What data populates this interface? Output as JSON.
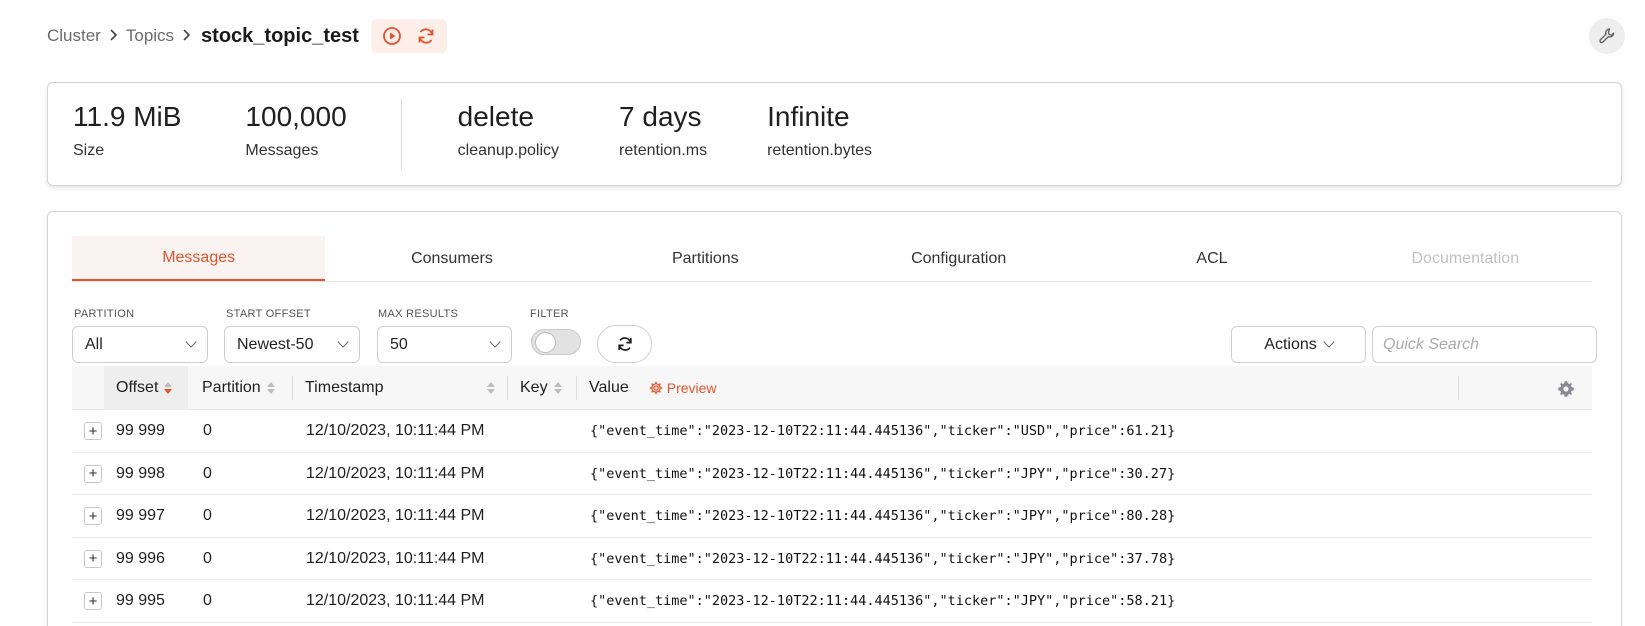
{
  "breadcrumb": {
    "items": [
      "Cluster",
      "Topics"
    ],
    "title": "stock_topic_test"
  },
  "header_icons": [
    "play-circle-icon",
    "refresh-icon",
    "wrench-icon"
  ],
  "stats": [
    {
      "value": "11.9 MiB",
      "label": "Size"
    },
    {
      "value": "100,000",
      "label": "Messages"
    },
    {
      "value": "delete",
      "label": "cleanup.policy"
    },
    {
      "value": "7 days",
      "label": "retention.ms"
    },
    {
      "value": "Infinite",
      "label": "retention.bytes"
    }
  ],
  "tabs": [
    {
      "label": "Messages",
      "state": "active"
    },
    {
      "label": "Consumers",
      "state": "normal"
    },
    {
      "label": "Partitions",
      "state": "normal"
    },
    {
      "label": "Configuration",
      "state": "normal"
    },
    {
      "label": "ACL",
      "state": "normal"
    },
    {
      "label": "Documentation",
      "state": "disabled"
    }
  ],
  "filters": {
    "partition": {
      "label": "PARTITION",
      "value": "All"
    },
    "start_offset": {
      "label": "START OFFSET",
      "value": "Newest-50"
    },
    "max_results": {
      "label": "MAX RESULTS",
      "value": "50"
    },
    "filter": {
      "label": "FILTER",
      "enabled": false
    },
    "actions_label": "Actions",
    "search_placeholder": "Quick Search"
  },
  "table": {
    "columns": {
      "offset": "Offset",
      "partition": "Partition",
      "timestamp": "Timestamp",
      "key": "Key",
      "value": "Value",
      "preview": "Preview"
    },
    "rows": [
      {
        "offset": "99 999",
        "partition": "0",
        "timestamp": "12/10/2023, 10:11:44 PM",
        "key": "",
        "value": "{\"event_time\":\"2023-12-10T22:11:44.445136\",\"ticker\":\"USD\",\"price\":61.21}"
      },
      {
        "offset": "99 998",
        "partition": "0",
        "timestamp": "12/10/2023, 10:11:44 PM",
        "key": "",
        "value": "{\"event_time\":\"2023-12-10T22:11:44.445136\",\"ticker\":\"JPY\",\"price\":30.27}"
      },
      {
        "offset": "99 997",
        "partition": "0",
        "timestamp": "12/10/2023, 10:11:44 PM",
        "key": "",
        "value": "{\"event_time\":\"2023-12-10T22:11:44.445136\",\"ticker\":\"JPY\",\"price\":80.28}"
      },
      {
        "offset": "99 996",
        "partition": "0",
        "timestamp": "12/10/2023, 10:11:44 PM",
        "key": "",
        "value": "{\"event_time\":\"2023-12-10T22:11:44.445136\",\"ticker\":\"JPY\",\"price\":37.78}"
      },
      {
        "offset": "99 995",
        "partition": "0",
        "timestamp": "12/10/2023, 10:11:44 PM",
        "key": "",
        "value": "{\"event_time\":\"2023-12-10T22:11:44.445136\",\"ticker\":\"JPY\",\"price\":58.21}"
      }
    ]
  },
  "colors": {
    "accent": "#e0552e",
    "accent_bg": "#fdeeea",
    "border": "#d4d4d4"
  }
}
